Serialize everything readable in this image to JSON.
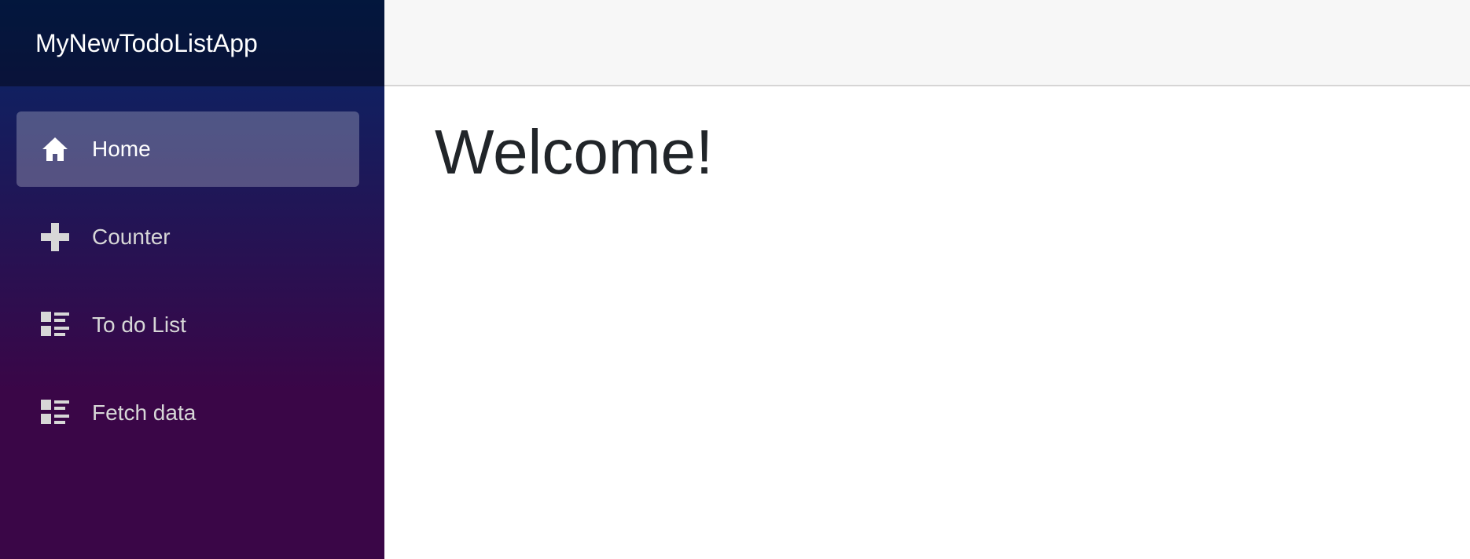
{
  "app": {
    "brand": "MyNewTodoListApp"
  },
  "sidebar": {
    "items": [
      {
        "label": "Home",
        "icon": "home-icon",
        "active": true
      },
      {
        "label": "Counter",
        "icon": "plus-icon",
        "active": false
      },
      {
        "label": "To do List",
        "icon": "list-rich-icon",
        "active": false
      },
      {
        "label": "Fetch data",
        "icon": "list-rich-icon",
        "active": false
      }
    ]
  },
  "main": {
    "title": "Welcome!"
  },
  "colors": {
    "sidebar_gradient_top": "#052767",
    "sidebar_gradient_bottom": "#3a0647",
    "top_row_bg": "#f7f7f7",
    "title_text": "#212529",
    "nav_text": "#d7d7d7",
    "nav_active_text": "#ffffff"
  }
}
